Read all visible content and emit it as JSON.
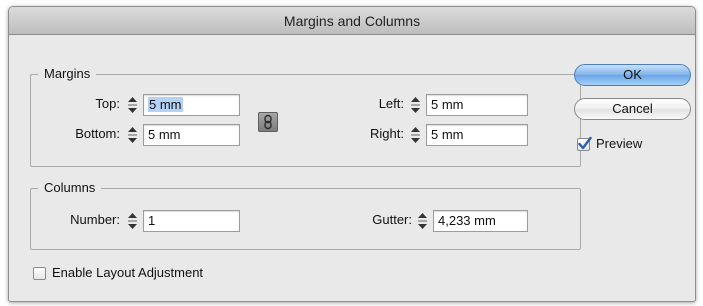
{
  "window": {
    "title": "Margins and Columns"
  },
  "margins": {
    "group_label": "Margins",
    "top": {
      "label": "Top:",
      "value_highlighted": "5 mm"
    },
    "bottom": {
      "label": "Bottom:",
      "value": "5 mm"
    },
    "left": {
      "label": "Left:",
      "value": "5 mm"
    },
    "right": {
      "label": "Right:",
      "value": "5 mm"
    },
    "link_icon": "chain-link-icon"
  },
  "columns": {
    "group_label": "Columns",
    "number": {
      "label": "Number:",
      "value": "1"
    },
    "gutter": {
      "label": "Gutter:",
      "value": "4,233 mm"
    }
  },
  "buttons": {
    "ok": "OK",
    "cancel": "Cancel"
  },
  "preview": {
    "label": "Preview",
    "checked": true
  },
  "layout_adjustment": {
    "label": "Enable Layout Adjustment",
    "checked": false
  },
  "colors": {
    "default_button": "#7eb3ea",
    "selection": "#b4d2f6",
    "check_mark": "#2b5fb5"
  }
}
